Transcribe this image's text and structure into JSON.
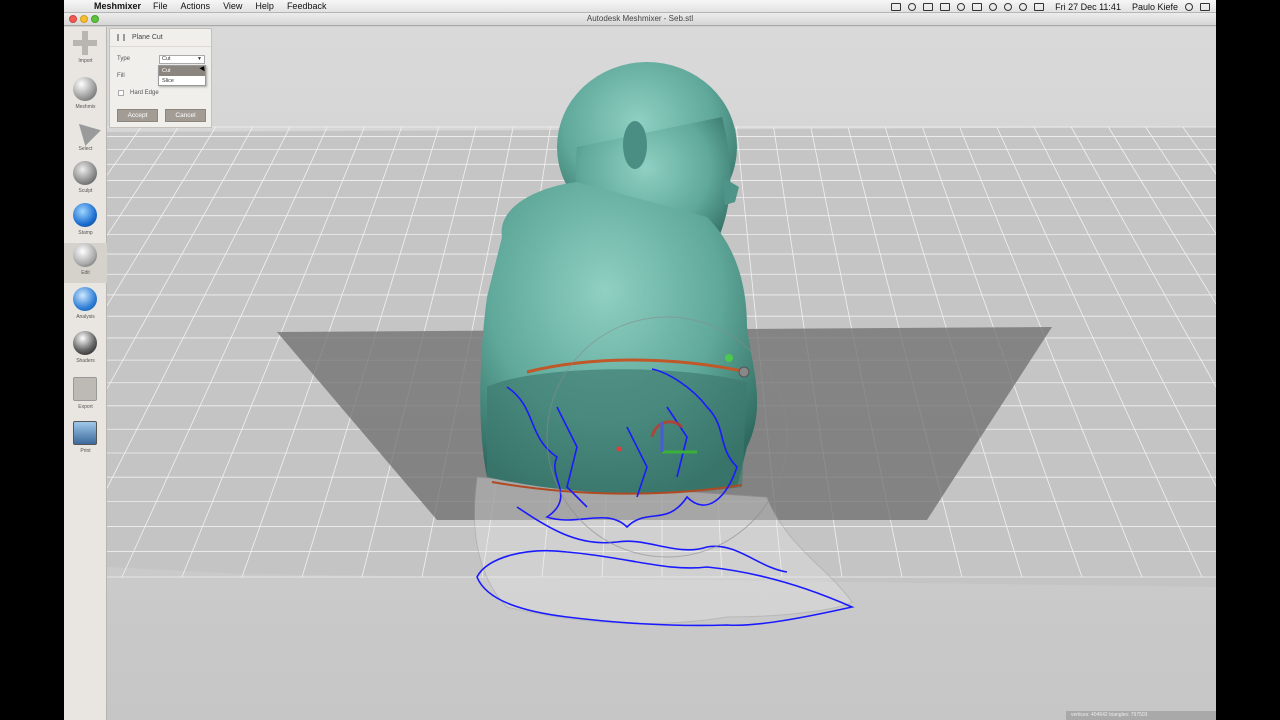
{
  "menubar": {
    "app_name": "Meshmixer",
    "items": [
      "File",
      "Actions",
      "View",
      "Help",
      "Feedback"
    ],
    "clock": "Fri 27 Dec  11:41",
    "user": "Paulo Kiefe"
  },
  "window": {
    "title": "Autodesk Meshmixer - Seb.stl"
  },
  "toolbar": {
    "tools": [
      {
        "label": "Import",
        "icon": "plus-icon"
      },
      {
        "label": "Meshmix",
        "icon": "sphere-icon"
      },
      {
        "label": "Select",
        "icon": "arrow-icon"
      },
      {
        "label": "Sculpt",
        "icon": "brush-icon"
      },
      {
        "label": "Stamp",
        "icon": "stamp-icon"
      },
      {
        "label": "Edit",
        "icon": "edit-icon"
      },
      {
        "label": "Analysis",
        "icon": "analysis-icon"
      },
      {
        "label": "Shaders",
        "icon": "shader-ball-icon"
      },
      {
        "label": "Export",
        "icon": "export-icon"
      },
      {
        "label": "Print",
        "icon": "print-icon"
      }
    ]
  },
  "panel": {
    "title": "Plane Cut",
    "type_label": "Type",
    "type_value": "Cut",
    "fill_label": "Fill",
    "options": [
      "Cut",
      "Slice"
    ],
    "hard_edge_label": "Hard Edge",
    "accept_label": "Accept",
    "cancel_label": "Cancel"
  },
  "status": {
    "stats": "vertices: 404642  triangles: 797503"
  },
  "colors": {
    "mesh": "#5fa89a",
    "outline": "#1a1aff",
    "plane": "#6e6e6e",
    "accent": "#f05a52"
  }
}
